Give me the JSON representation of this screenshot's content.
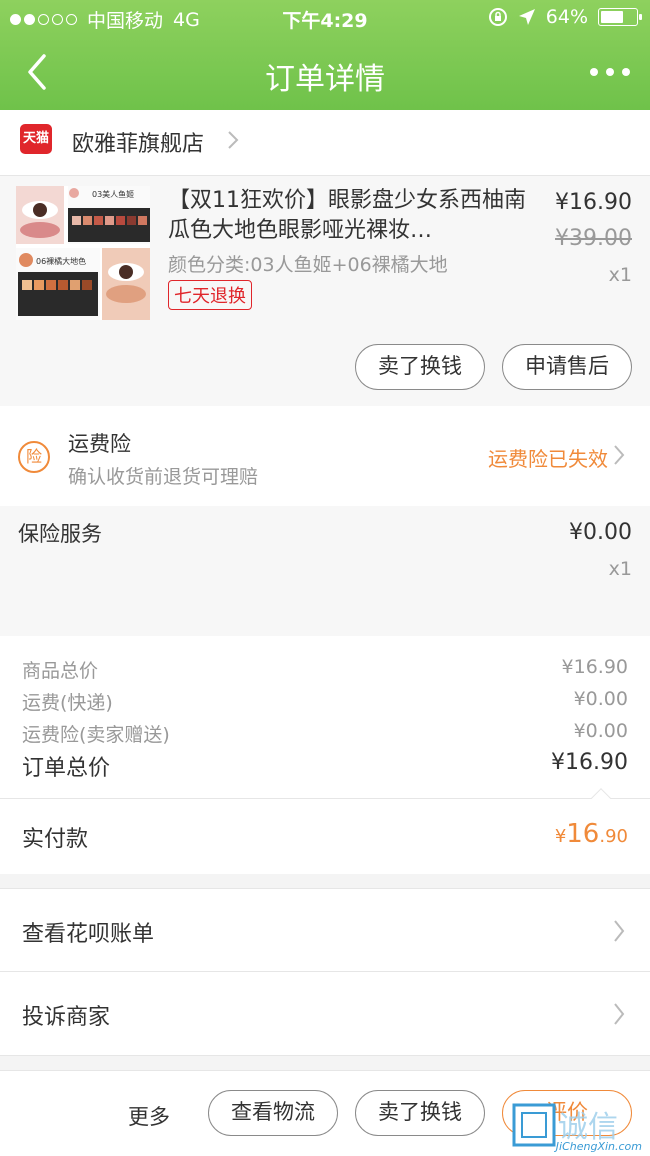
{
  "status_bar": {
    "carrier": "中国移动",
    "network": "4G",
    "time": "下午4:29",
    "battery": "64%",
    "battery_level": 0.64
  },
  "nav": {
    "title": "订单详情"
  },
  "store": {
    "name": "欧雅菲旗舰店",
    "badge": "天猫"
  },
  "product": {
    "title": "【双11狂欢价】眼影盘少女系西柚南瓜色大地色眼影哑光裸妆…",
    "spec": "颜色分类:03人鱼姬+06裸橘大地",
    "badge": "七天退换",
    "price": "¥16.90",
    "original_price": "¥39.00",
    "quantity": "x1",
    "thumb_label_1": "03美人鱼姬",
    "thumb_label_2": "06裸橘大地色",
    "buttons": {
      "sell": "卖了换钱",
      "aftersale": "申请售后"
    }
  },
  "freight_insurance": {
    "icon_text": "险",
    "title": "运费险",
    "subtitle": "确认收货前退货可理赔",
    "status": "运费险已失效"
  },
  "insurance_service": {
    "title": "保险服务",
    "price": "¥0.00",
    "quantity": "x1"
  },
  "totals": {
    "goods_label": "商品总价",
    "goods_value": "¥16.90",
    "shipping_label": "运费(快递)",
    "shipping_value": "¥0.00",
    "insurance_label": "运费险(卖家赠送)",
    "insurance_value": "¥0.00",
    "order_total_label": "订单总价",
    "order_total_value": "¥16.90"
  },
  "paid": {
    "label": "实付款",
    "currency": "¥",
    "integer": "16",
    "decimal": ".90"
  },
  "menu": {
    "huabei": "查看花呗账单",
    "complain": "投诉商家"
  },
  "bottom_bar": {
    "more": "更多",
    "logistics": "查看物流",
    "sell": "卖了换钱",
    "review": "评价"
  },
  "watermark": {
    "text": "JiChengXin.com",
    "logo_text": "集诚信"
  },
  "colors": {
    "header_green": "#7ccb52",
    "accent_orange": "#f08a3a",
    "tmall_red": "#e0262b"
  }
}
